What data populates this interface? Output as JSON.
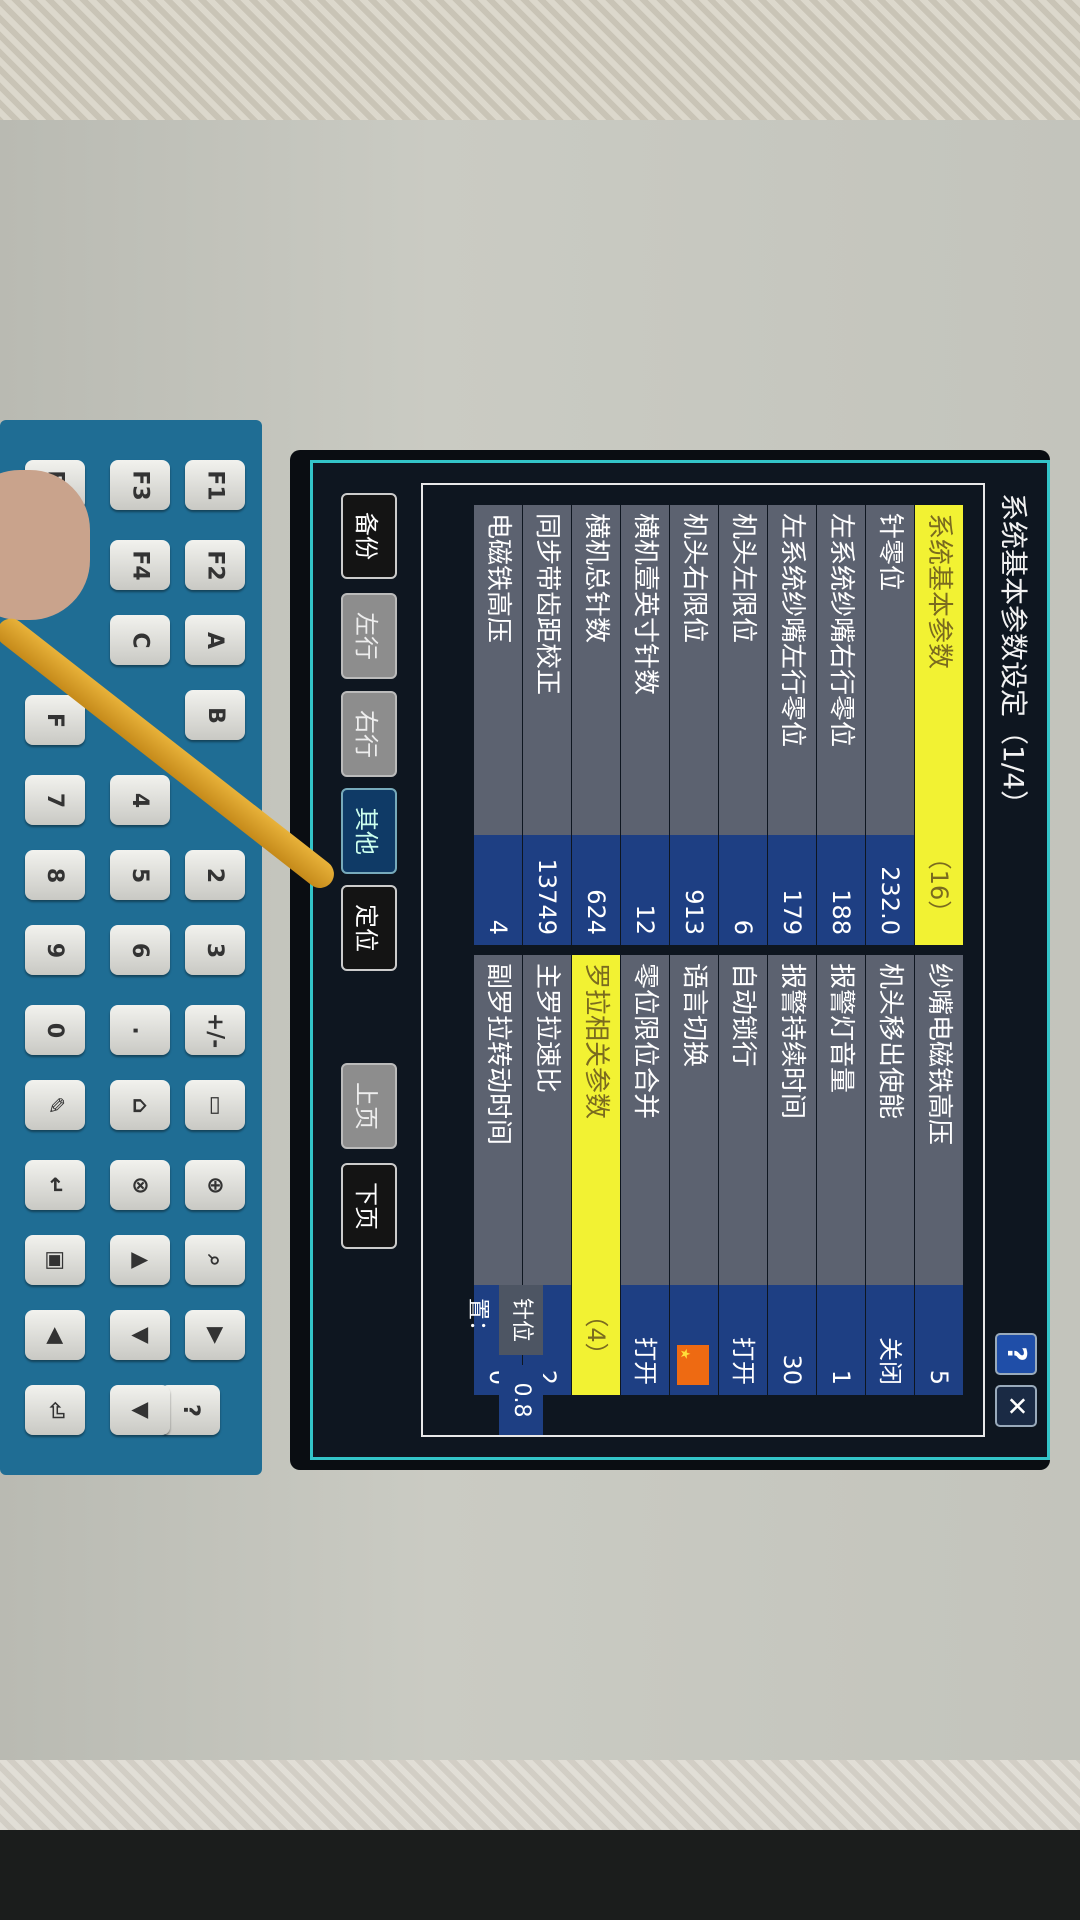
{
  "screen": {
    "title": "系统基本参数设定（1/4）",
    "help_label": "?",
    "close_label": "✕",
    "left_params": [
      {
        "label": "系统基本参数",
        "value": "（16）",
        "highlight": true
      },
      {
        "label": "针零位",
        "value": "232.0"
      },
      {
        "label": "左系统纱嘴右行零位",
        "value": "188"
      },
      {
        "label": "左系统纱嘴左行零位",
        "value": "179"
      },
      {
        "label": "机头左限位",
        "value": "6"
      },
      {
        "label": "机头右限位",
        "value": "913"
      },
      {
        "label": "横机壹英寸针数",
        "value": "12"
      },
      {
        "label": "横机总针数",
        "value": "624"
      },
      {
        "label": "同步带齿距校正",
        "value": "13749"
      },
      {
        "label": "电磁铁高压",
        "value": "4"
      }
    ],
    "right_params": [
      {
        "label": "纱嘴电磁铁高压",
        "value": "5"
      },
      {
        "label": "机头移出使能",
        "value": "关闭"
      },
      {
        "label": "报警灯音量",
        "value": "1"
      },
      {
        "label": "报警持续时间",
        "value": "30"
      },
      {
        "label": "自动锁行",
        "value": "打开"
      },
      {
        "label": "语言切换",
        "value": "",
        "flag": true
      },
      {
        "label": "零位限位合并",
        "value": "打开"
      },
      {
        "label": "罗拉相关参数",
        "value": "（4）",
        "highlight": true
      },
      {
        "label": "主罗拉速比",
        "value": "2"
      },
      {
        "label": "副罗拉转动时间",
        "value": "0"
      }
    ],
    "needle_position": {
      "label": "针位置：",
      "value": "0.8"
    },
    "buttons": {
      "backup": "备份",
      "left_row": "左行",
      "right_row": "右行",
      "other": "其他",
      "locate": "定位",
      "prev_page": "上页",
      "next_page": "下页"
    }
  },
  "keypad": {
    "keys": [
      "F1",
      "F2",
      "A",
      "B",
      "2",
      "3",
      "+/-",
      "F3",
      "F4",
      "C",
      "4",
      "5",
      "6",
      ".",
      "F5",
      "F",
      "7",
      "8",
      "9",
      "0",
      "?"
    ]
  },
  "colors": {
    "label_bg": "#5c6270",
    "value_bg": "#1e3f83",
    "highlight": "#f2f233",
    "screen_border": "#33c4c8",
    "keypad": "#1f6d94"
  }
}
